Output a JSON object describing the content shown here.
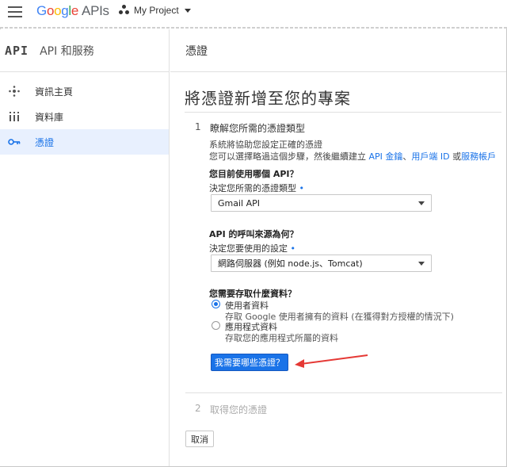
{
  "header": {
    "logo_google": [
      "G",
      "o",
      "o",
      "g",
      "l",
      "e"
    ],
    "logo_suffix": "APIs",
    "project_name": "My Project"
  },
  "sidebar": {
    "api_mark": "API",
    "title": "API 和服務",
    "items": [
      {
        "label": "資訊主頁",
        "icon": "dashboard-icon"
      },
      {
        "label": "資料庫",
        "icon": "library-icon"
      },
      {
        "label": "憑證",
        "icon": "key-icon",
        "active": true
      }
    ]
  },
  "main": {
    "section_title": "憑證",
    "page_title": "將憑證新增至您的專案",
    "step1": {
      "number": "1",
      "title": "瞭解您所需的憑證類型",
      "desc_line1": "系統將協助您設定正確的憑證",
      "desc_line2_prefix": "您可以選擇略過這個步驟，然後繼續建立 ",
      "link_api_key": "API 金鑰",
      "sep1": "、",
      "link_oauth": "用戶端 ID",
      "sep2": " 或",
      "link_service": "服務帳戶",
      "q_api": "您目前使用哪個 API？",
      "q_api_sub": "決定您所需的憑證類型",
      "api_select_value": "Gmail API",
      "q_source": "API 的呼叫來源為何？",
      "q_source_sub": "決定您要使用的設定",
      "source_select_value": "網路伺服器 (例如 node.js、Tomcat)",
      "q_data": "您需要存取什麼資料？",
      "radio_user_label": "使用者資料",
      "radio_user_desc": "存取 Google 使用者擁有的資料 (在獲得對方授權的情況下)",
      "radio_app_label": "應用程式資料",
      "radio_app_desc": "存取您的應用程式所屬的資料",
      "selected": "使用者資料",
      "submit_label": "我需要哪些憑證？"
    },
    "step2": {
      "number": "2",
      "title": "取得您的憑證"
    },
    "cancel_label": "取消"
  },
  "colors": {
    "accent": "#1a73e8",
    "annotation_arrow": "#e53935"
  }
}
